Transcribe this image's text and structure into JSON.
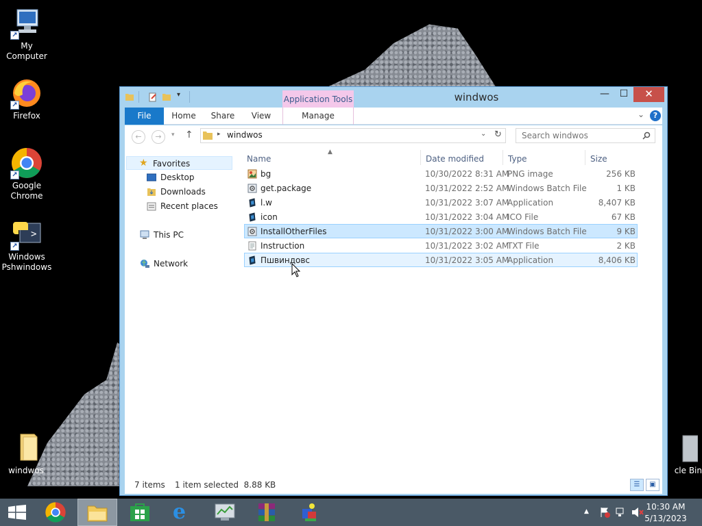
{
  "desktop": {
    "icons": [
      {
        "label": "My Computer",
        "icon": "computer-icon"
      },
      {
        "label": "Firefox",
        "icon": "firefox-icon"
      },
      {
        "label": "Google Chrome",
        "icon": "chrome-icon"
      },
      {
        "label": "Windows Pshwindows",
        "icon": "python-icon"
      },
      {
        "label": "windwos",
        "icon": "folder-icon"
      },
      {
        "label": "cle Bin",
        "icon": "recycle-bin-icon"
      }
    ]
  },
  "window": {
    "title": "windwos",
    "context_tab": "Application Tools",
    "ribbon_tabs": [
      "File",
      "Home",
      "Share",
      "View",
      "Manage"
    ],
    "address_path": "windwos",
    "search_placeholder": "Search windwos",
    "colors": {
      "file_tab": "#1979ca",
      "context_tab": "#f4c8ea",
      "close": "#c7504a",
      "selection": "#cce8ff"
    }
  },
  "nav": {
    "favorites": "Favorites",
    "items": [
      "Desktop",
      "Downloads",
      "Recent places"
    ],
    "this_pc": "This PC",
    "network": "Network"
  },
  "columns": [
    "Name",
    "Date modified",
    "Type",
    "Size"
  ],
  "files": [
    {
      "name": "bg",
      "date": "10/30/2022 8:31 AM",
      "type": "PNG image",
      "size": "256 KB",
      "icon": "png-image-icon",
      "state": "normal"
    },
    {
      "name": "get.package",
      "date": "10/31/2022 2:52 AM",
      "type": "Windows Batch File",
      "size": "1 KB",
      "icon": "batch-file-icon",
      "state": "normal"
    },
    {
      "name": "l.w",
      "date": "10/31/2022 3:07 AM",
      "type": "Application",
      "size": "8,407 KB",
      "icon": "application-icon",
      "state": "normal"
    },
    {
      "name": "icon",
      "date": "10/31/2022 3:04 AM",
      "type": "ICO File",
      "size": "67 KB",
      "icon": "ico-file-icon",
      "state": "normal"
    },
    {
      "name": "InstallOtherFiles",
      "date": "10/31/2022 3:00 AM",
      "type": "Windows Batch File",
      "size": "9 KB",
      "icon": "batch-file-icon",
      "state": "selected"
    },
    {
      "name": "Instruction",
      "date": "10/31/2022 3:02 AM",
      "type": "TXT File",
      "size": "2 KB",
      "icon": "text-file-icon",
      "state": "normal"
    },
    {
      "name": "Пшвиндовс",
      "date": "10/31/2022 3:05 AM",
      "type": "Application",
      "size": "8,406 KB",
      "icon": "application-icon",
      "state": "hover"
    }
  ],
  "status": {
    "items": "7 items",
    "selection": "1 item selected  8.88 KB"
  },
  "taskbar": {
    "apps": [
      "start-icon",
      "chrome-icon",
      "file-explorer-icon",
      "store-icon",
      "internet-explorer-icon",
      "task-manager-icon",
      "winrar-icon",
      "app-icon"
    ],
    "time": "10:30 AM",
    "date": "5/13/2023"
  }
}
